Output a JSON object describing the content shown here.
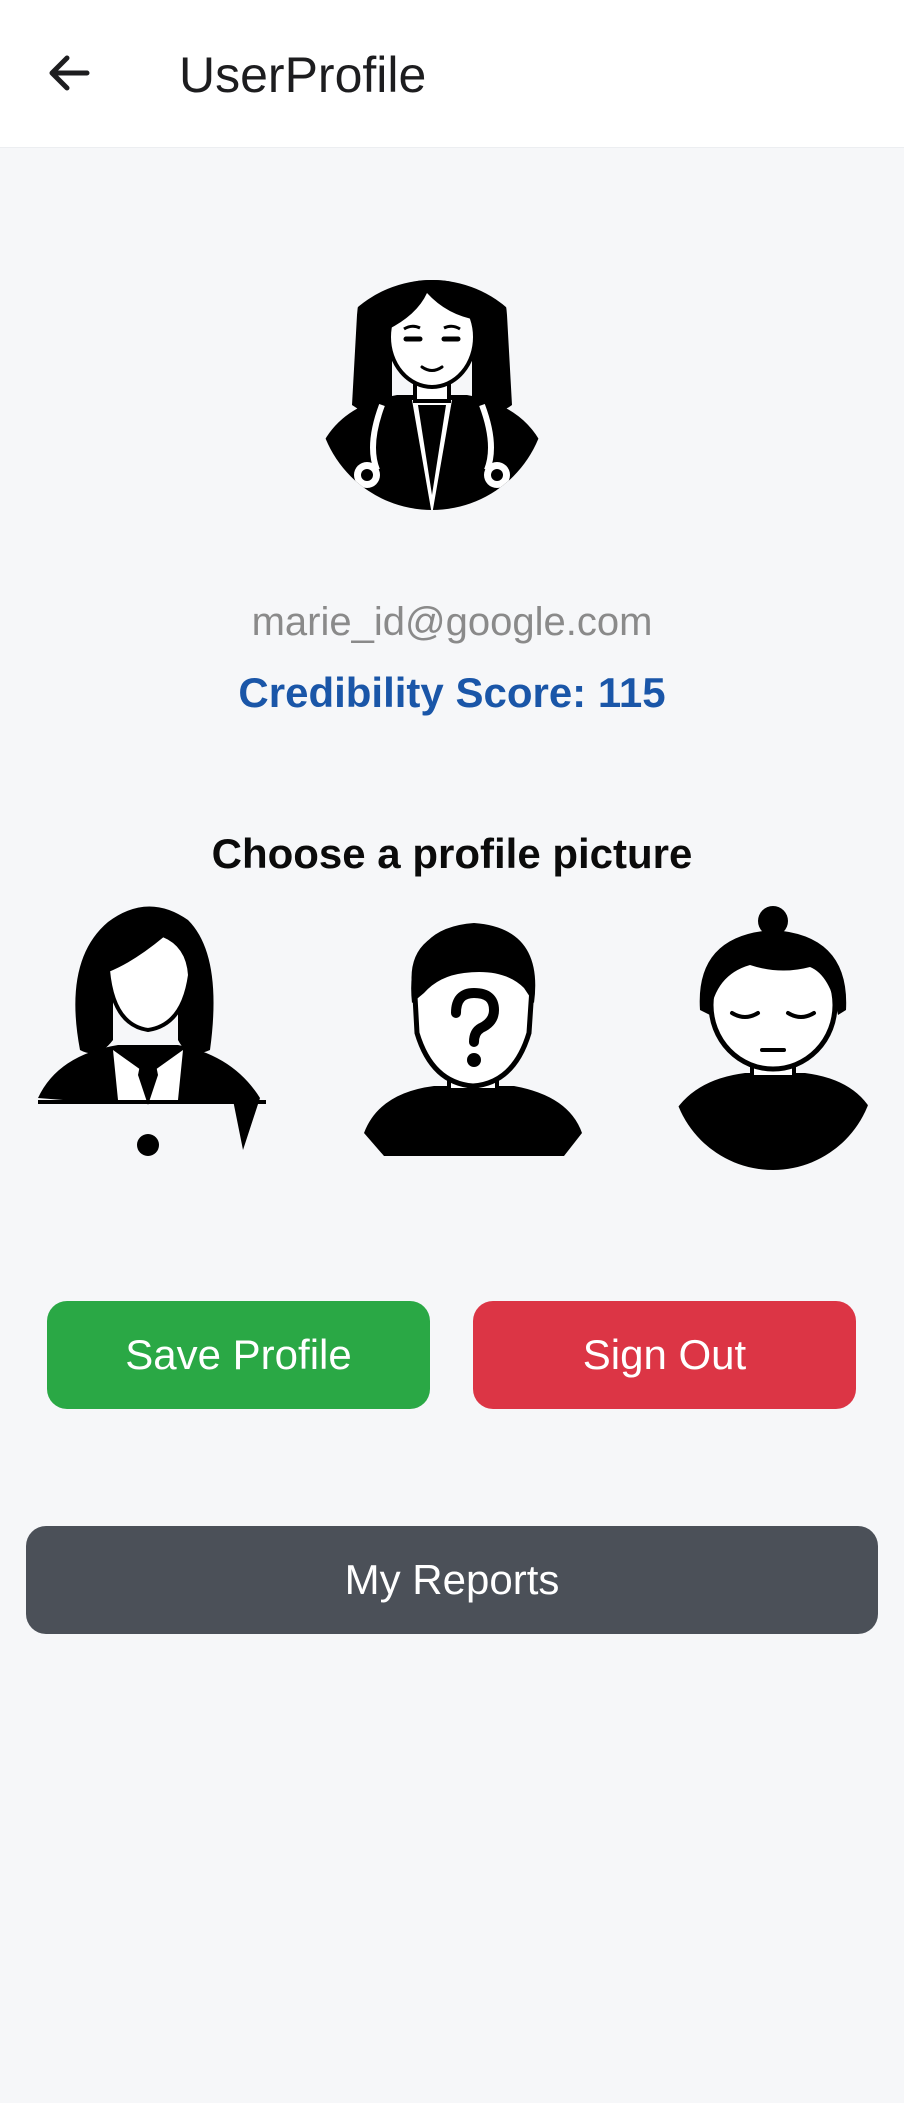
{
  "header": {
    "title": "UserProfile",
    "back_icon": "arrow-left-icon"
  },
  "profile": {
    "email": "marie_id@google.com",
    "credibility_label": "Credibility Score: 115",
    "credibility_score": 115,
    "avatar_icon": "doctor-woman-avatar-icon"
  },
  "picker": {
    "heading": "Choose a profile picture",
    "options": [
      {
        "icon": "businesswoman-avatar-icon"
      },
      {
        "icon": "unknown-man-avatar-icon"
      },
      {
        "icon": "woman-bun-avatar-icon"
      }
    ]
  },
  "actions": {
    "save_label": "Save Profile",
    "signout_label": "Sign Out",
    "reports_label": "My Reports"
  },
  "colors": {
    "save": "#2aa845",
    "signout": "#dc3545",
    "reports": "#4b5058",
    "score_text": "#1a56a8"
  }
}
